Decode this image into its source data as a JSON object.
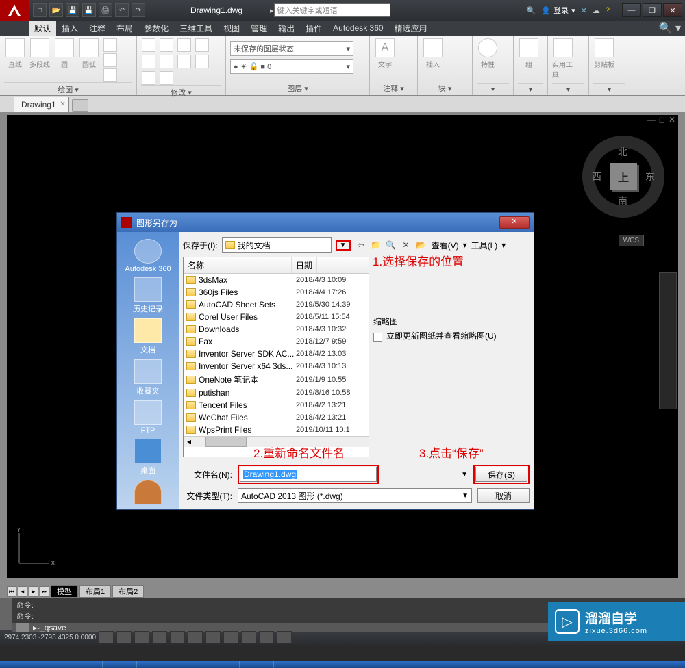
{
  "title": "Drawing1.dwg",
  "search_placeholder": "键入关键字或短语",
  "login_label": "登录",
  "menubar": [
    "默认",
    "插入",
    "注释",
    "布局",
    "参数化",
    "三维工具",
    "视图",
    "管理",
    "输出",
    "插件",
    "Autodesk 360",
    "精选应用"
  ],
  "ribbon": {
    "draw_label": "绘图 ▾",
    "draw_tools": [
      "直线",
      "多段线",
      "圆",
      "",
      "圆弧",
      ""
    ],
    "modify_label": "修改 ▾",
    "layer_label": "图层 ▾",
    "layer_state": "未保存的图层状态",
    "annotate_label": "注释 ▾",
    "annotate_tool": "文字",
    "block_label": "块 ▾",
    "block_tool": "插入",
    "props_label": "特性",
    "group_label": "组",
    "util_label": "实用工具",
    "clip_label": "剪贴板"
  },
  "filetab": "Drawing1",
  "viewcube": {
    "top": "上",
    "n": "北",
    "s": "南",
    "e": "东",
    "w": "西"
  },
  "wcs": "WCS",
  "dialog": {
    "title": "图形另存为",
    "savein_label": "保存于(I):",
    "savein_value": "我的文档",
    "nav_view": "查看(V)",
    "nav_tools": "工具(L)",
    "sidebar": [
      "Autodesk 360",
      "历史记录",
      "文档",
      "收藏夹",
      "FTP",
      "桌面"
    ],
    "col_name": "名称",
    "col_date": "日期",
    "files": [
      {
        "name": "3dsMax",
        "date": "2018/4/3 10:09"
      },
      {
        "name": "360js Files",
        "date": "2018/4/4 17:26"
      },
      {
        "name": "AutoCAD Sheet Sets",
        "date": "2019/5/30 14:39"
      },
      {
        "name": "Corel User Files",
        "date": "2018/5/11 15:54"
      },
      {
        "name": "Downloads",
        "date": "2018/4/3 10:32"
      },
      {
        "name": "Fax",
        "date": "2018/12/7 9:59"
      },
      {
        "name": "Inventor Server SDK AC...",
        "date": "2018/4/2 13:03"
      },
      {
        "name": "Inventor Server x64 3ds...",
        "date": "2018/4/3 10:13"
      },
      {
        "name": "OneNote 笔记本",
        "date": "2019/1/9 10:55"
      },
      {
        "name": "putishan",
        "date": "2019/8/16 10:58"
      },
      {
        "name": "Tencent Files",
        "date": "2018/4/2 13:21"
      },
      {
        "name": "WeChat Files",
        "date": "2018/4/2 13:21"
      },
      {
        "name": "WpsPrint Files",
        "date": "2019/10/11 10:1"
      }
    ],
    "preview_label": "缩略图",
    "preview_chk": "立即更新图纸并查看缩略图(U)",
    "fname_label": "文件名(N):",
    "fname_value": "Drawing1.dwg",
    "ftype_label": "文件类型(T):",
    "ftype_value": "AutoCAD 2013 图形 (*.dwg)",
    "save_btn": "保存(S)",
    "cancel_btn": "取消"
  },
  "annotations": {
    "a1": "1.选择保存的位置",
    "a2": "2.重新命名文件名",
    "a3": "3.点击“保存”"
  },
  "layout_tabs": [
    "模型",
    "布局1",
    "布局2"
  ],
  "cmd_hist": [
    "命令:",
    "命令:"
  ],
  "cmd_input": "-_qsave",
  "coords": "2974 2303  -2793 4325   0 0000",
  "watermark": {
    "brand": "溜溜自学",
    "url": "zixue.3d66.com"
  }
}
